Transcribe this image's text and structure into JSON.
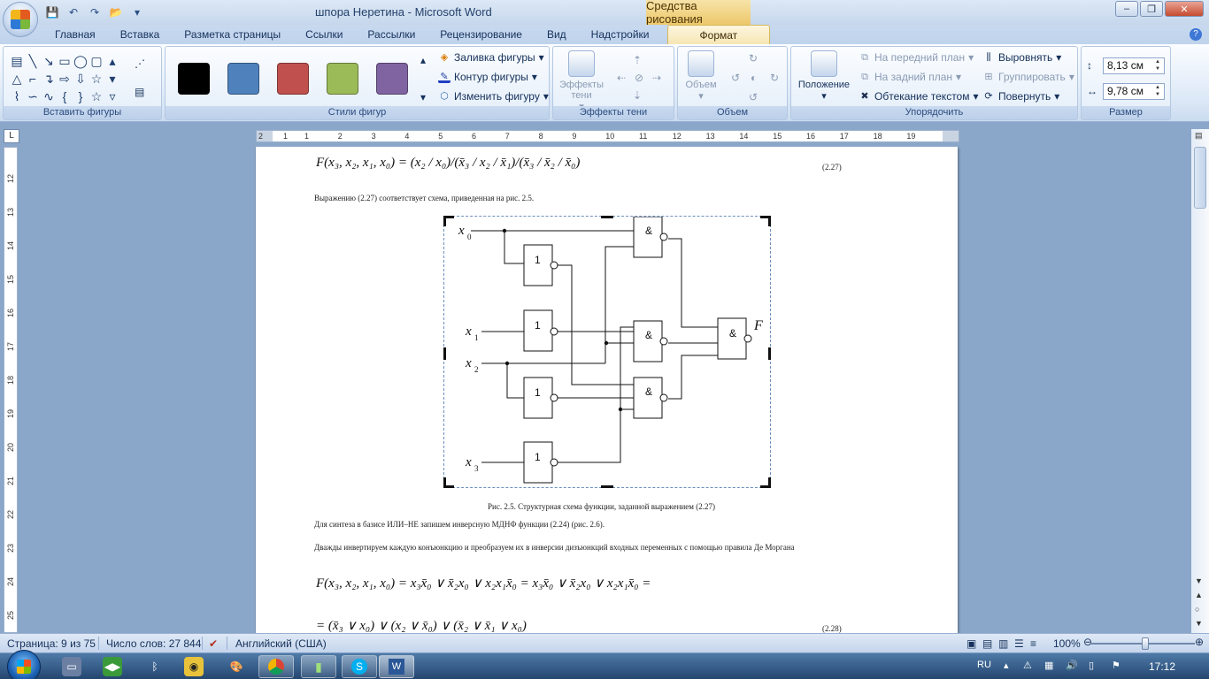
{
  "window": {
    "title": "шпора Неретина - Microsoft Word",
    "context_tab": "Средства рисования",
    "controls": [
      "–",
      "❐",
      "✕"
    ]
  },
  "tabs": [
    "Главная",
    "Вставка",
    "Разметка страницы",
    "Ссылки",
    "Рассылки",
    "Рецензирование",
    "Вид",
    "Надстройки",
    "Формат"
  ],
  "active_tab": "Формат",
  "ribbon": {
    "insert_shapes_label": "Вставить фигуры",
    "shape_styles_label": "Стили фигур",
    "swatch_colors": [
      "#000000",
      "#4f81bd",
      "#c0504d",
      "#9bbb59",
      "#8064a2"
    ],
    "fill_label": "Заливка фигуры",
    "outline_label": "Контур фигуры",
    "change_label": "Изменить фигуру",
    "shadow_btn": "Эффекты тени",
    "shadow_group": "Эффекты тени",
    "volume_btn": "Объем",
    "volume_group": "Объем",
    "position_btn": "Положение",
    "front_label": "На передний план",
    "back_label": "На задний план",
    "wrap_label": "Обтекание текстом",
    "align_label": "Выровнять",
    "group_label": "Группировать",
    "rotate_label": "Повернуть",
    "arrange_group": "Упорядочить",
    "height_value": "8,13 см",
    "width_value": "9,78 см",
    "size_group": "Размер"
  },
  "ruler": {
    "h_numbers": [
      "2",
      "1",
      "1",
      "2",
      "3",
      "4",
      "5",
      "6",
      "7",
      "8",
      "9",
      "10",
      "11",
      "12",
      "13",
      "14",
      "15",
      "16",
      "17",
      "18",
      "19"
    ],
    "v_numbers": [
      "12",
      "13",
      "14",
      "15",
      "16",
      "17",
      "18",
      "19",
      "20",
      "21",
      "22",
      "23",
      "24",
      "25"
    ]
  },
  "document": {
    "formula_227": "F(x₃, x₂, x₁, x₀) = (x₂ / x₀)/(x̄₃ / x₂ / x̄₁)/(x̄₃ / x̄₂ / x̄₀)",
    "eq_227": "(2.27)",
    "line1": "Выражению (2.27) соответствует схема, приведенная на рис. 2.5.",
    "caption": "Рис. 2.5. Структурная схема функции, заданной выражением (2.27)",
    "line2": "Для синтеза в базисе ИЛИ–НЕ запишем инверсную МДНФ функции (2.24) (рис. 2.6).",
    "line3": "Дважды инвертируем каждую конъюнкцию и преобразуем их в инверсии дизъюнкций входных переменных с помощью правила Де Моргана",
    "formula_228a": "F(x₃, x₂, x₁, x₀) = x₃x̄₀ ∨ x̄₂x₀ ∨ x₂x₁x̄₀ = x₃x̄₀ ∨ x̄₂x₀ ∨ x₂x₁x̄₀ =",
    "formula_228b": "= (x̄₃ ∨ x₀) ∨ (x₂ ∨ x̄₀) ∨ (x̄₂ ∨ x̄₁ ∨ x₀)",
    "eq_228": "(2.28)"
  },
  "circuit": {
    "or_label": "1",
    "and_label": "&",
    "inputs": [
      "x",
      "x",
      "x",
      "x"
    ],
    "input_subs": [
      "0",
      "1",
      "2",
      "3"
    ],
    "output": "F"
  },
  "status": {
    "page": "Страница: 9 из 75",
    "words": "Число слов: 27 844",
    "language": "Английский (США)",
    "zoom": "100%"
  },
  "taskbar": {
    "lang": "RU",
    "time": "17:12"
  }
}
